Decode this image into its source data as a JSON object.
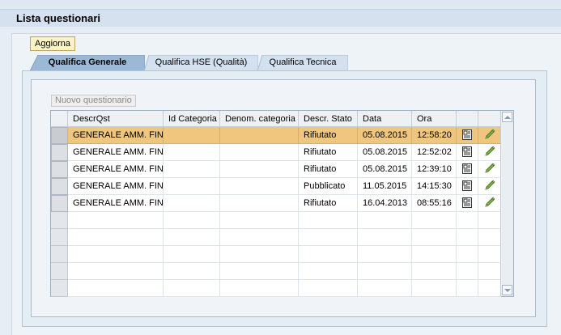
{
  "page": {
    "title": "Lista questionari"
  },
  "toolbar": {
    "refresh_label": "Aggiorna"
  },
  "tabs": [
    {
      "label": "Qualifica Generale",
      "active": true
    },
    {
      "label": "Qualifica HSE (Qualità)",
      "active": false
    },
    {
      "label": "Qualifica Tecnica",
      "active": false
    }
  ],
  "table": {
    "new_button_label": "Nuovo questionario",
    "columns": [
      "DescrQst",
      "Id Categoria",
      "Denom. categoria",
      "Descr. Stato",
      "Data",
      "Ora"
    ],
    "rows": [
      {
        "descr": "GENERALE AMM. FIN.",
        "id_categoria": "",
        "denom_categoria": "",
        "stato": "Rifiutato",
        "data": "05.08.2015",
        "ora": "12:58:20",
        "selected": true
      },
      {
        "descr": "GENERALE AMM. FIN.",
        "id_categoria": "",
        "denom_categoria": "",
        "stato": "Rifiutato",
        "data": "05.08.2015",
        "ora": "12:52:02",
        "selected": false
      },
      {
        "descr": "GENERALE AMM. FIN.",
        "id_categoria": "",
        "denom_categoria": "",
        "stato": "Rifiutato",
        "data": "05.08.2015",
        "ora": "12:39:10",
        "selected": false
      },
      {
        "descr": "GENERALE AMM. FIN.",
        "id_categoria": "",
        "denom_categoria": "",
        "stato": "Pubblicato",
        "data": "11.05.2015",
        "ora": "14:15:30",
        "selected": false
      },
      {
        "descr": "GENERALE AMM. FIN.",
        "id_categoria": "",
        "denom_categoria": "",
        "stato": "Rifiutato",
        "data": "16.04.2013",
        "ora": "08:55:16",
        "selected": false
      }
    ],
    "empty_rows": 5,
    "row_icons": [
      "display-document-icon",
      "edit-pencil-icon"
    ]
  },
  "colors": {
    "selected_row": "#f0c67e",
    "refresh_button_bg": "#fbf3c5",
    "active_tab": "#9ab8d6",
    "title_bar": "#d5e1ee"
  }
}
